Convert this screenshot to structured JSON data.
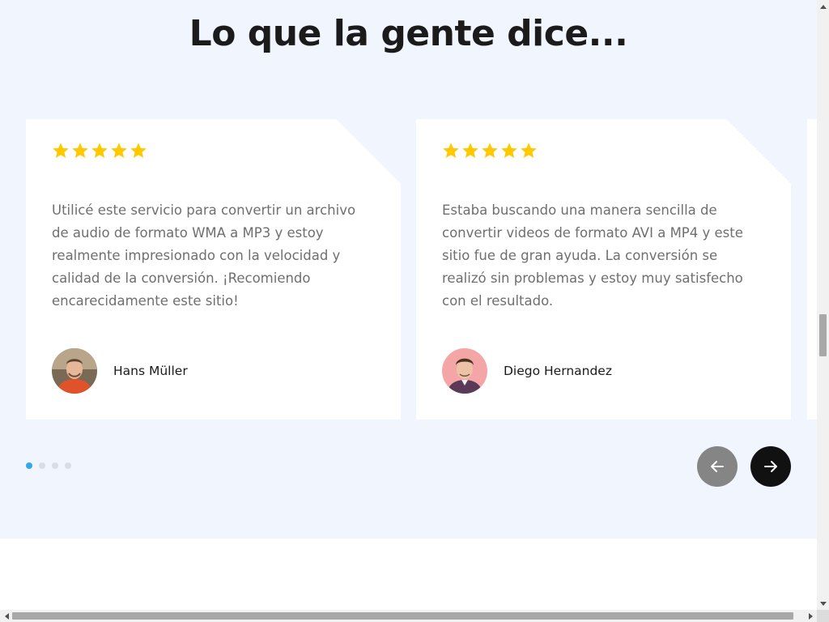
{
  "section": {
    "title": "Lo que la gente dice..."
  },
  "testimonials": [
    {
      "rating": 5,
      "quote": "Utilicé este servicio para convertir un archivo de audio de formato WMA a MP3 y estoy realmente impresionado con la velocidad y calidad de la conversión. ¡Recomiendo encarecidamente este sitio!",
      "author": "Hans Müller"
    },
    {
      "rating": 5,
      "quote": "Estaba buscando una manera sencilla de convertir videos de formato AVI a MP4 y este sitio fue de gran ayuda. La conversión se realizó sin problemas y estoy muy satisfecho con el resultado.",
      "author": "Diego Hernandez"
    }
  ],
  "carousel": {
    "dot_count": 4,
    "active_dot": 0,
    "prev_icon": "arrow-left-icon",
    "next_icon": "arrow-right-icon"
  },
  "colors": {
    "section_bg": "#f1f5fe",
    "star": "#ffc800",
    "dot_active": "#2fa8f0",
    "prev_button": "#858585",
    "next_button": "#111111"
  }
}
